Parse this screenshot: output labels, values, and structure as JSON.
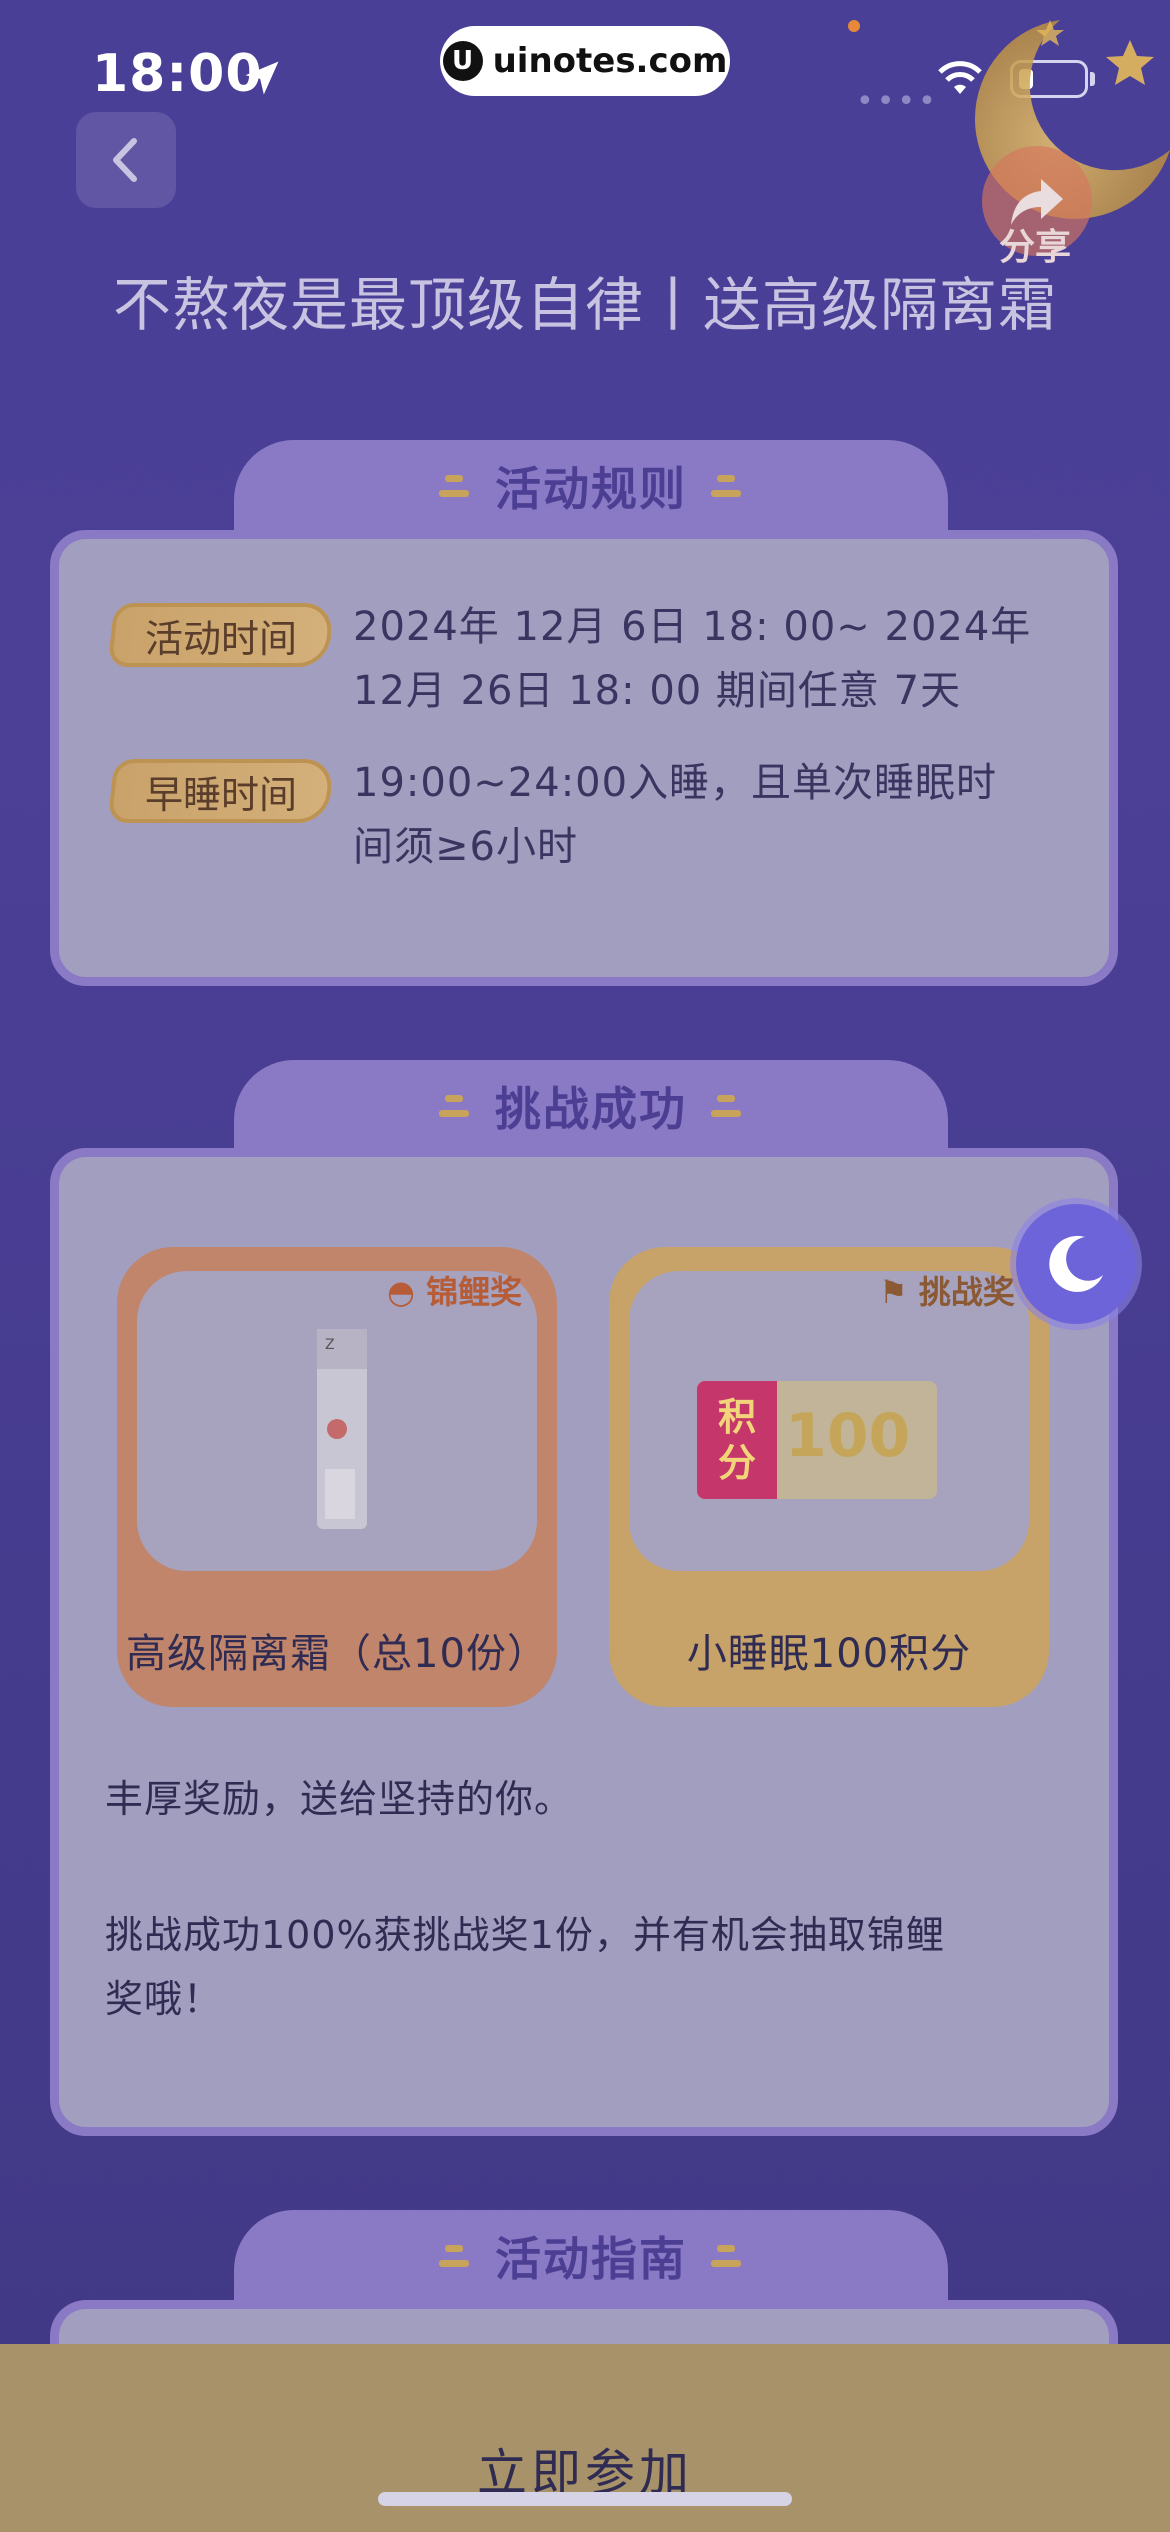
{
  "status_bar": {
    "time": "18:00"
  },
  "watermark": {
    "logo": "U",
    "text": "uinotes.com"
  },
  "header": {
    "back_icon": "chevron-left-icon",
    "share_label": "分享",
    "title": "不熬夜是最顶级自律丨送高级隔离霜"
  },
  "rules": {
    "tab_label": "活动规则",
    "items": [
      {
        "badge": "活动时间",
        "lines": [
          "2024年 12月 6日 18: 00~ 2024年",
          "12月 26日 18: 00 期间任意 7天"
        ]
      },
      {
        "badge": "早睡时间",
        "lines": [
          "19:00~24:00入睡，且单次睡眠时",
          "间须≥6小时"
        ]
      }
    ]
  },
  "challenge": {
    "tab_label": "挑战成功",
    "prizes": [
      {
        "tag": "锦鲤奖",
        "label": "高级隔离霜（总10份）"
      },
      {
        "tag": "挑战奖",
        "label": "小睡眠100积分",
        "coupon_left": "积\n分",
        "coupon_value": "100"
      }
    ],
    "desc_1": "丰厚奖励，送给坚持的你。",
    "desc_2_line1": "挑战成功100%获挑战奖1份，并有机会抽取锦鲤",
    "desc_2_line2": "奖哦！"
  },
  "guide": {
    "tab_label": "活动指南"
  },
  "footer": {
    "join_label": "立即参加"
  },
  "colors": {
    "accent": "#8a79c4",
    "gold": "#c8a35b",
    "background": "#4a3f97"
  }
}
